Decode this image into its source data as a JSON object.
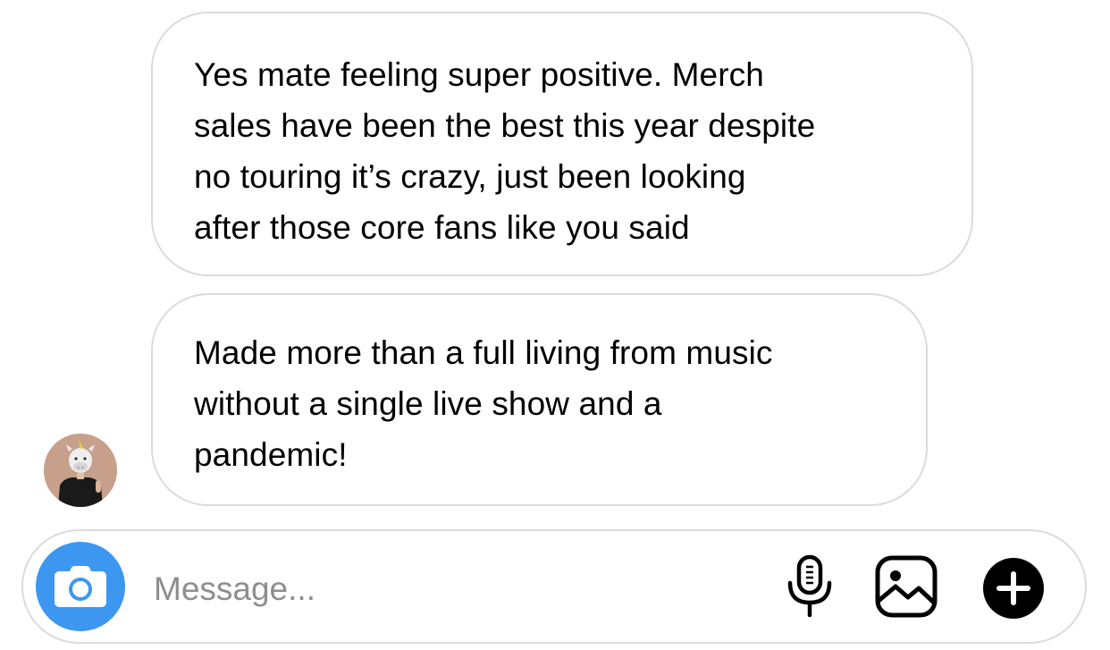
{
  "messages": [
    {
      "lines": [
        "Yes mate feeling super positive. Merch",
        "sales have been the best this year despite",
        "no touring it’s crazy, just been looking",
        "after those core fans like you said"
      ]
    },
    {
      "lines": [
        "Made more than a full living from music",
        "without a single live show and a",
        "pandemic!"
      ]
    }
  ],
  "composer": {
    "placeholder": "Message...",
    "icons": {
      "camera": "camera-icon",
      "mic": "microphone-icon",
      "gallery": "image-gallery-icon",
      "plus": "plus-icon"
    }
  },
  "colors": {
    "camera_button": "#3d97f0",
    "bubble_border": "#dbdbdb",
    "placeholder": "#8e8e8e"
  }
}
